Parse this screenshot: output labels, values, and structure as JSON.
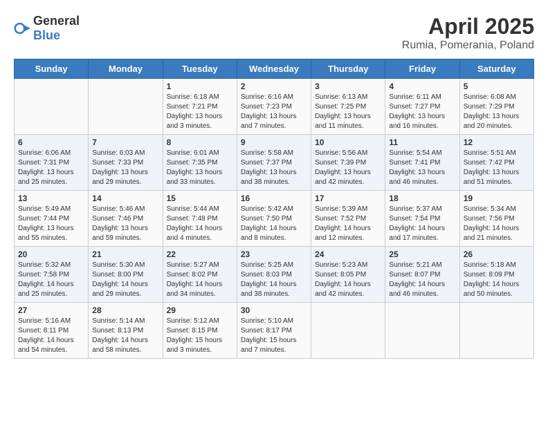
{
  "header": {
    "logo_general": "General",
    "logo_blue": "Blue",
    "title": "April 2025",
    "subtitle": "Rumia, Pomerania, Poland"
  },
  "weekdays": [
    "Sunday",
    "Monday",
    "Tuesday",
    "Wednesday",
    "Thursday",
    "Friday",
    "Saturday"
  ],
  "weeks": [
    [
      {
        "day": "",
        "info": ""
      },
      {
        "day": "",
        "info": ""
      },
      {
        "day": "1",
        "info": "Sunrise: 6:18 AM\nSunset: 7:21 PM\nDaylight: 13 hours and 3 minutes."
      },
      {
        "day": "2",
        "info": "Sunrise: 6:16 AM\nSunset: 7:23 PM\nDaylight: 13 hours and 7 minutes."
      },
      {
        "day": "3",
        "info": "Sunrise: 6:13 AM\nSunset: 7:25 PM\nDaylight: 13 hours and 11 minutes."
      },
      {
        "day": "4",
        "info": "Sunrise: 6:11 AM\nSunset: 7:27 PM\nDaylight: 13 hours and 16 minutes."
      },
      {
        "day": "5",
        "info": "Sunrise: 6:08 AM\nSunset: 7:29 PM\nDaylight: 13 hours and 20 minutes."
      }
    ],
    [
      {
        "day": "6",
        "info": "Sunrise: 6:06 AM\nSunset: 7:31 PM\nDaylight: 13 hours and 25 minutes."
      },
      {
        "day": "7",
        "info": "Sunrise: 6:03 AM\nSunset: 7:33 PM\nDaylight: 13 hours and 29 minutes."
      },
      {
        "day": "8",
        "info": "Sunrise: 6:01 AM\nSunset: 7:35 PM\nDaylight: 13 hours and 33 minutes."
      },
      {
        "day": "9",
        "info": "Sunrise: 5:58 AM\nSunset: 7:37 PM\nDaylight: 13 hours and 38 minutes."
      },
      {
        "day": "10",
        "info": "Sunrise: 5:56 AM\nSunset: 7:39 PM\nDaylight: 13 hours and 42 minutes."
      },
      {
        "day": "11",
        "info": "Sunrise: 5:54 AM\nSunset: 7:41 PM\nDaylight: 13 hours and 46 minutes."
      },
      {
        "day": "12",
        "info": "Sunrise: 5:51 AM\nSunset: 7:42 PM\nDaylight: 13 hours and 51 minutes."
      }
    ],
    [
      {
        "day": "13",
        "info": "Sunrise: 5:49 AM\nSunset: 7:44 PM\nDaylight: 13 hours and 55 minutes."
      },
      {
        "day": "14",
        "info": "Sunrise: 5:46 AM\nSunset: 7:46 PM\nDaylight: 13 hours and 59 minutes."
      },
      {
        "day": "15",
        "info": "Sunrise: 5:44 AM\nSunset: 7:48 PM\nDaylight: 14 hours and 4 minutes."
      },
      {
        "day": "16",
        "info": "Sunrise: 5:42 AM\nSunset: 7:50 PM\nDaylight: 14 hours and 8 minutes."
      },
      {
        "day": "17",
        "info": "Sunrise: 5:39 AM\nSunset: 7:52 PM\nDaylight: 14 hours and 12 minutes."
      },
      {
        "day": "18",
        "info": "Sunrise: 5:37 AM\nSunset: 7:54 PM\nDaylight: 14 hours and 17 minutes."
      },
      {
        "day": "19",
        "info": "Sunrise: 5:34 AM\nSunset: 7:56 PM\nDaylight: 14 hours and 21 minutes."
      }
    ],
    [
      {
        "day": "20",
        "info": "Sunrise: 5:32 AM\nSunset: 7:58 PM\nDaylight: 14 hours and 25 minutes."
      },
      {
        "day": "21",
        "info": "Sunrise: 5:30 AM\nSunset: 8:00 PM\nDaylight: 14 hours and 29 minutes."
      },
      {
        "day": "22",
        "info": "Sunrise: 5:27 AM\nSunset: 8:02 PM\nDaylight: 14 hours and 34 minutes."
      },
      {
        "day": "23",
        "info": "Sunrise: 5:25 AM\nSunset: 8:03 PM\nDaylight: 14 hours and 38 minutes."
      },
      {
        "day": "24",
        "info": "Sunrise: 5:23 AM\nSunset: 8:05 PM\nDaylight: 14 hours and 42 minutes."
      },
      {
        "day": "25",
        "info": "Sunrise: 5:21 AM\nSunset: 8:07 PM\nDaylight: 14 hours and 46 minutes."
      },
      {
        "day": "26",
        "info": "Sunrise: 5:18 AM\nSunset: 8:09 PM\nDaylight: 14 hours and 50 minutes."
      }
    ],
    [
      {
        "day": "27",
        "info": "Sunrise: 5:16 AM\nSunset: 8:11 PM\nDaylight: 14 hours and 54 minutes."
      },
      {
        "day": "28",
        "info": "Sunrise: 5:14 AM\nSunset: 8:13 PM\nDaylight: 14 hours and 58 minutes."
      },
      {
        "day": "29",
        "info": "Sunrise: 5:12 AM\nSunset: 8:15 PM\nDaylight: 15 hours and 3 minutes."
      },
      {
        "day": "30",
        "info": "Sunrise: 5:10 AM\nSunset: 8:17 PM\nDaylight: 15 hours and 7 minutes."
      },
      {
        "day": "",
        "info": ""
      },
      {
        "day": "",
        "info": ""
      },
      {
        "day": "",
        "info": ""
      }
    ]
  ]
}
